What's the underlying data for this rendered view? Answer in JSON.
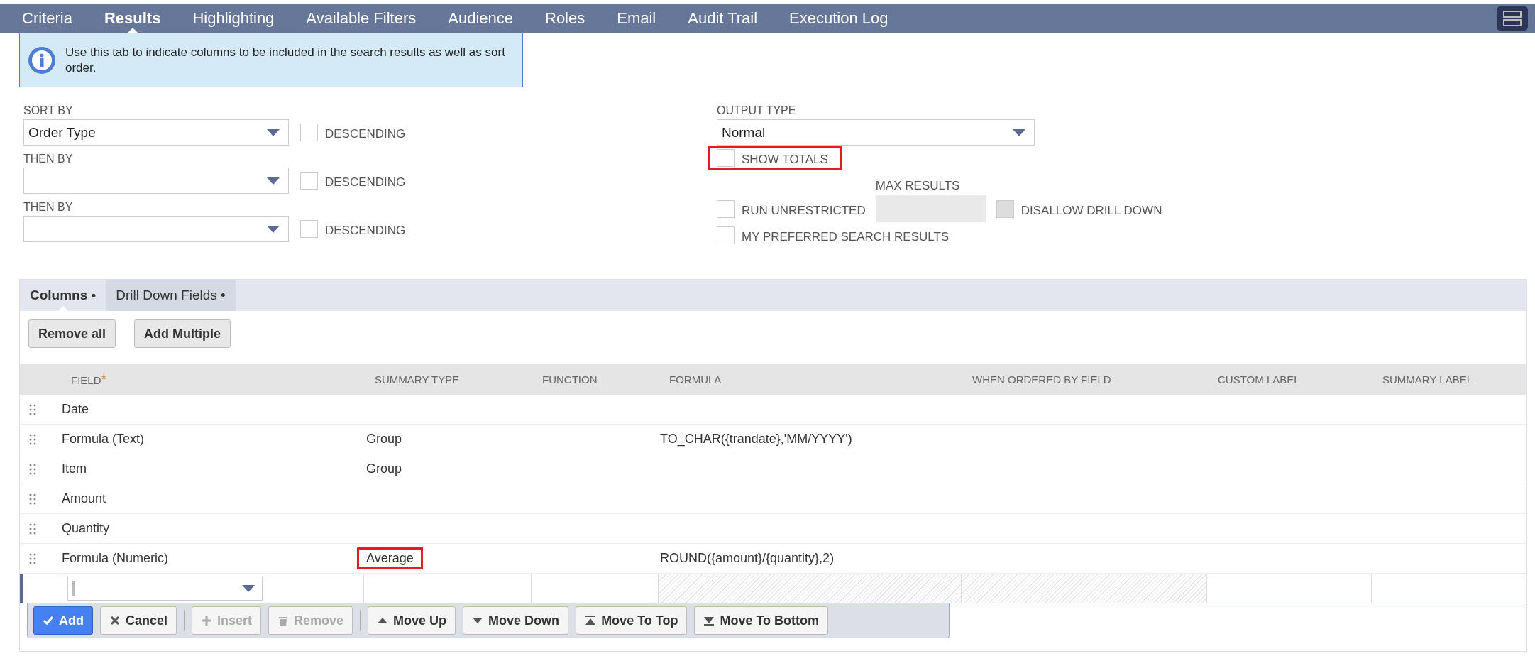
{
  "tabs": [
    {
      "label": "Criteria",
      "selected": false
    },
    {
      "label": "Results",
      "selected": true
    },
    {
      "label": "Highlighting",
      "selected": false
    },
    {
      "label": "Available Filters",
      "selected": false
    },
    {
      "label": "Audience",
      "selected": false
    },
    {
      "label": "Roles",
      "selected": false
    },
    {
      "label": "Email",
      "selected": false
    },
    {
      "label": "Audit Trail",
      "selected": false
    },
    {
      "label": "Execution Log",
      "selected": false
    }
  ],
  "info": "Use this tab to indicate columns to be included in the search results as well as sort order.",
  "sort": [
    {
      "label": "SORT BY",
      "value": "Order Type",
      "descending": {
        "label": "DESCENDING",
        "checked": false
      }
    },
    {
      "label": "THEN BY",
      "descending": {
        "label": "DESCENDING",
        "checked": false
      }
    },
    {
      "label": "THEN BY",
      "descending": {
        "label": "DESCENDING",
        "checked": false
      }
    }
  ],
  "output_type": {
    "label": "OUTPUT TYPE",
    "value": "Normal"
  },
  "show_totals": {
    "label": "SHOW TOTALS",
    "checked": false,
    "highlighted": true
  },
  "run_unrestricted": {
    "label": "RUN UNRESTRICTED",
    "checked": false
  },
  "max_results": {
    "label": "MAX RESULTS"
  },
  "disallow_drill_down": {
    "label": "DISALLOW DRILL DOWN",
    "checked": false,
    "disabled": true
  },
  "my_preferred": {
    "label": "MY PREFERRED SEARCH RESULTS",
    "checked": false
  },
  "subtabs": [
    {
      "label": "Columns •",
      "selected": true
    },
    {
      "label": "Drill Down Fields •",
      "selected": false
    }
  ],
  "actions": [
    "Remove all",
    "Add Multiple"
  ],
  "table": {
    "columns": [
      {
        "label": "FIELD",
        "required_mark": "*"
      },
      {
        "label": "SUMMARY TYPE"
      },
      {
        "label": "FUNCTION"
      },
      {
        "label": "FORMULA"
      },
      {
        "label": "WHEN ORDERED BY FIELD"
      },
      {
        "label": "CUSTOM LABEL"
      },
      {
        "label": "SUMMARY LABEL"
      }
    ],
    "rows": [
      {
        "cells": [
          "Date",
          "",
          "",
          "",
          "",
          "",
          ""
        ],
        "highlighted_cell": false
      },
      {
        "cells": [
          "Formula (Text)",
          "Group",
          "",
          "TO_CHAR({trandate},'MM/YYYY')",
          "",
          "",
          ""
        ],
        "highlighted_cell": false
      },
      {
        "cells": [
          "Item",
          "Group",
          "",
          "",
          "",
          "",
          ""
        ],
        "highlighted_cell": false
      },
      {
        "cells": [
          "Amount",
          "",
          "",
          "",
          "",
          "",
          ""
        ],
        "highlighted_cell": false
      },
      {
        "cells": [
          "Quantity",
          "",
          "",
          "",
          "",
          "",
          ""
        ],
        "highlighted_cell": false
      },
      {
        "cells": [
          "Formula (Numeric)",
          "Average",
          "",
          "ROUND({amount}/{quantity},2)",
          "",
          "",
          ""
        ],
        "highlighted_cell": true
      }
    ]
  },
  "edit_buttons": [
    {
      "label": "Add",
      "kind": "primary",
      "disabled": false
    },
    {
      "label": "Cancel",
      "kind": "normal",
      "disabled": false
    },
    {
      "label": "Insert",
      "kind": "normal",
      "disabled": true
    },
    {
      "label": "Remove",
      "kind": "normal",
      "disabled": true
    },
    {
      "label": "Move Up",
      "kind": "normal",
      "disabled": false
    },
    {
      "label": "Move Down",
      "kind": "normal",
      "disabled": false
    },
    {
      "label": "Move To Top",
      "kind": "normal",
      "disabled": false
    },
    {
      "label": "Move To Bottom",
      "kind": "normal",
      "disabled": false
    }
  ]
}
